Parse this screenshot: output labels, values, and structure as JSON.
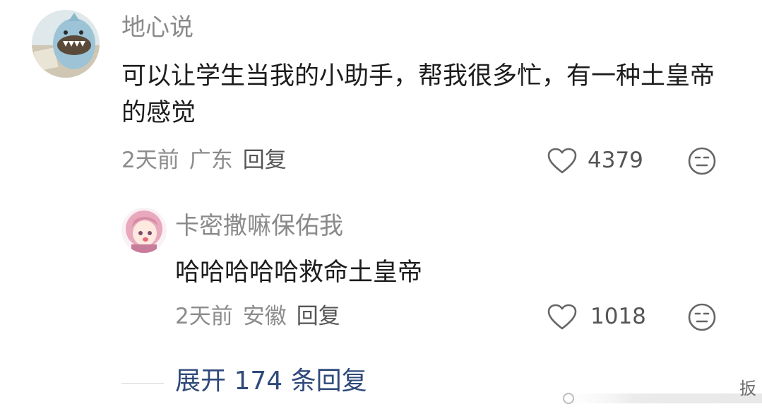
{
  "comment1": {
    "author": "地心说",
    "text": "可以让学生当我的小助手，帮我很多忙，有一种土皇帝的感觉",
    "time": "2天前",
    "location": "广东",
    "reply_label": "回复",
    "likes": "4379",
    "like_icon": "heart-outline",
    "dislike_icon": "meh-face"
  },
  "reply1": {
    "author": "卡密撒嘛保佑我",
    "text": "哈哈哈哈哈救命土皇帝",
    "time": "2天前",
    "location": "安徽",
    "reply_label": "回复",
    "likes": "1018",
    "like_icon": "heart-outline",
    "dislike_icon": "meh-face"
  },
  "expand_replies": "展开 174 条回复",
  "watermark": {
    "text": "扳"
  },
  "colors": {
    "name": "#8a8a8a",
    "body": "#1c1c1c",
    "meta": "#8c8c8c",
    "link": "#2f4a7a",
    "avatar1_bg": "#c9dde6",
    "avatar2_bg": "#f7e1ea"
  }
}
